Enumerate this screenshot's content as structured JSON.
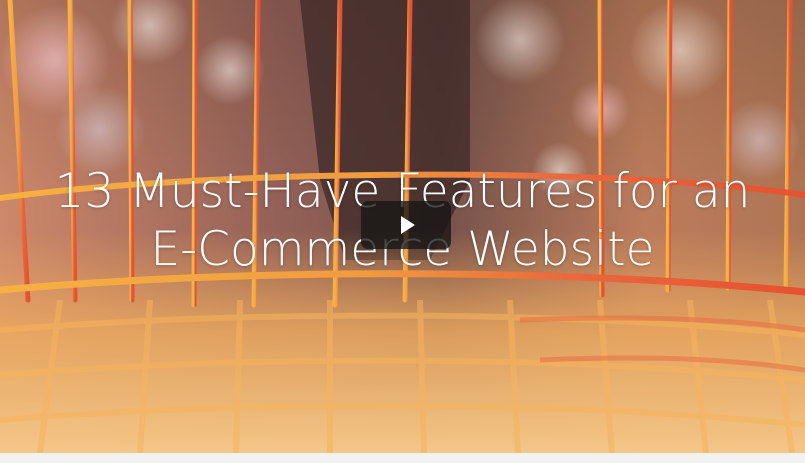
{
  "video": {
    "title_line_1": "13 Must-Have Features for an",
    "title_line_2": "E-Commerce Website",
    "play_icon": "play-icon"
  },
  "colors": {
    "basket_orange": "#f0913c",
    "basket_red": "#e0462a",
    "basket_yellow": "#f4b63f",
    "overlay_button": "#161616",
    "title_text": "#ffffff"
  }
}
